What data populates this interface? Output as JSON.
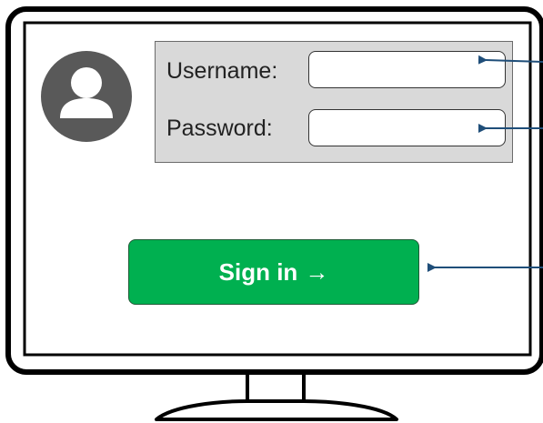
{
  "login_form": {
    "username_label": "Username:",
    "username_value": "",
    "password_label": "Password:",
    "password_value": "",
    "signin_label": "Sign in",
    "signin_arrow": "→"
  },
  "icons": {
    "user_avatar": "user-avatar-icon",
    "pointer_arrows": "arrow-left-icon"
  },
  "colors": {
    "monitor_outline": "#000000",
    "form_panel_bg": "#d9d9d9",
    "button_bg": "#00b050",
    "button_text": "#ffffff",
    "avatar_bg": "#595959",
    "pointer_arrow": "#1f4e79"
  }
}
